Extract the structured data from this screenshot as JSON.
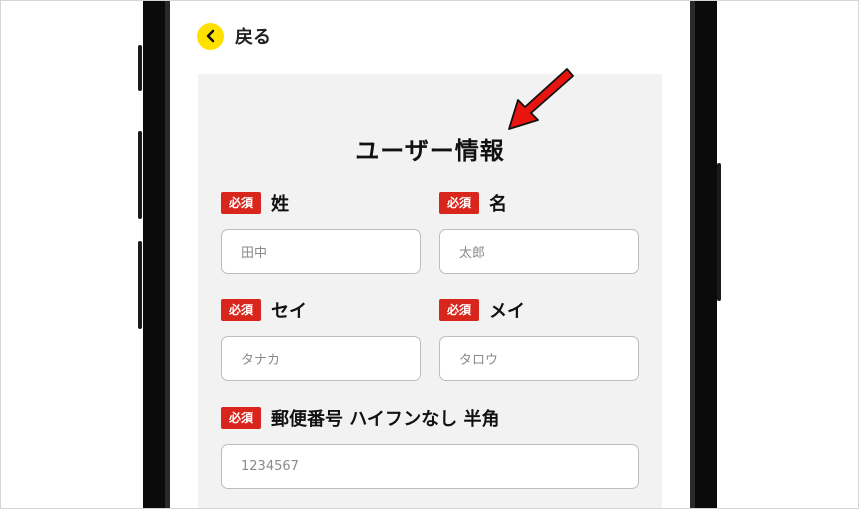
{
  "header": {
    "back_label": "戻る"
  },
  "form": {
    "title": "ユーザー情報",
    "required_badge": "必須",
    "fields": [
      {
        "label": "姓",
        "placeholder": "田中"
      },
      {
        "label": "名",
        "placeholder": "太郎"
      },
      {
        "label": "セイ",
        "placeholder": "タナカ"
      },
      {
        "label": "メイ",
        "placeholder": "タロウ"
      },
      {
        "label": "郵便番号 ハイフンなし 半角",
        "placeholder": "1234567"
      }
    ]
  },
  "colors": {
    "accent_yellow": "#ffe100",
    "required_red": "#d9261c",
    "annotation_arrow": "#e8140f"
  },
  "icons": {
    "back": "chevron-left-icon",
    "annotation": "red-arrow-icon"
  }
}
